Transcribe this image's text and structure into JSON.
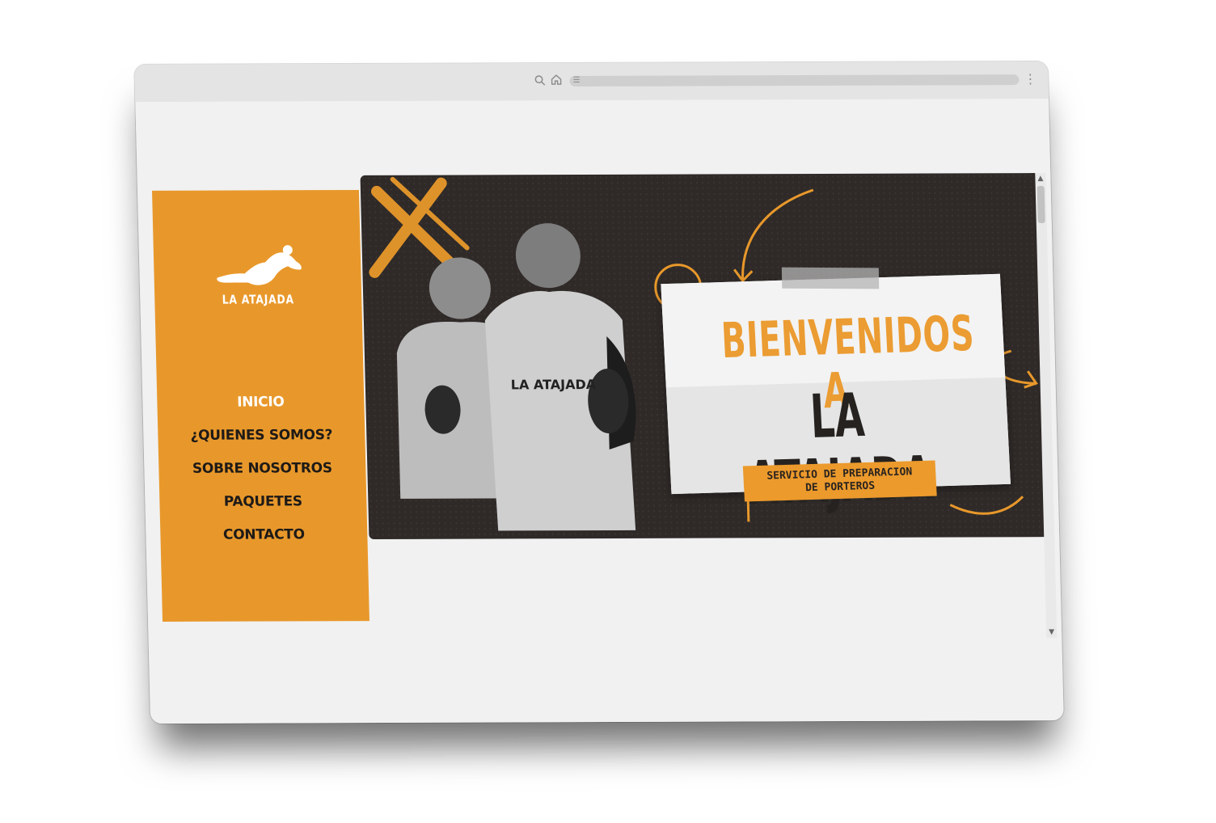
{
  "browser": {
    "window_controls": [
      "close",
      "minimize",
      "maximize"
    ],
    "toolbar_icons": [
      "search-icon",
      "home-icon",
      "settings-icon"
    ],
    "menu_icon": "more-vertical-icon"
  },
  "sidebar": {
    "brand": "LA ATAJADA",
    "logo_icon": "goalkeeper-diving-icon",
    "nav": [
      {
        "label": "INICIO",
        "active": true
      },
      {
        "label": "¿QUIENES SOMOS?",
        "active": false
      },
      {
        "label": "SOBRE NOSOTROS",
        "active": false
      },
      {
        "label": "PAQUETES",
        "active": false
      },
      {
        "label": "CONTACTO",
        "active": false
      }
    ]
  },
  "hero": {
    "title_line1": "BIENVENIDOS A",
    "title_line2": "LA ATAJADA",
    "subtitle_line1": "SERVICIO DE PREPARACION",
    "subtitle_line2": "DE PORTEROS",
    "shirt_text": "LA ATAJADA"
  },
  "colors": {
    "accent": "#e8982b",
    "hero_background": "#2f2a28",
    "nav_text": "#1e1a17",
    "nav_active_text": "#ffffff"
  }
}
